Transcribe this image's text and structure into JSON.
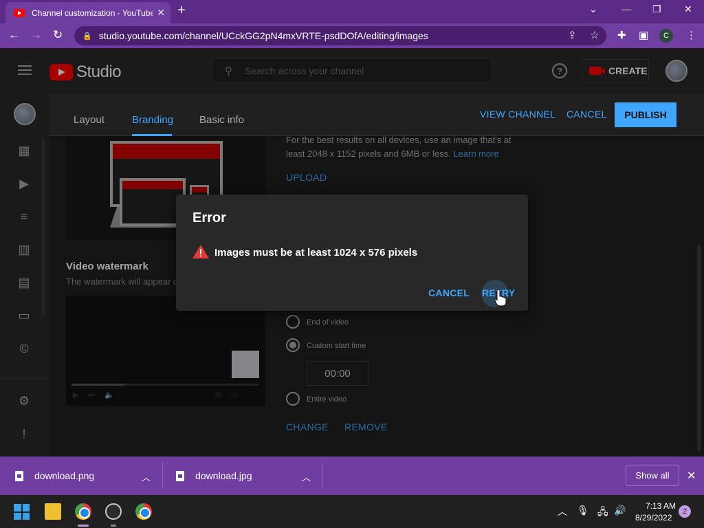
{
  "browser": {
    "tab_title": "Channel customization - YouTube",
    "url": "studio.youtube.com/channel/UCckGG2pN4mxVRTE-psdDOfA/editing/images",
    "profile_initial": "C",
    "accent_color": "#6f3ea0"
  },
  "studio": {
    "logo_text": "Studio",
    "search_placeholder": "Search across your channel",
    "create_label": "CREATE"
  },
  "tabs": [
    {
      "label": "Layout",
      "active": false
    },
    {
      "label": "Branding",
      "active": true
    },
    {
      "label": "Basic info",
      "active": false
    }
  ],
  "header_actions": {
    "view_channel": "VIEW CHANNEL",
    "cancel": "CANCEL",
    "publish": "PUBLISH"
  },
  "banner": {
    "best_text": "For the best results on all devices, use an image that's at least 2048 x 1152 pixels and 6MB or less.",
    "learn_more": "Learn more",
    "upload": "UPLOAD"
  },
  "watermark": {
    "title": "Video watermark",
    "description": "The watermark will appear o",
    "options": [
      {
        "label": "End of video",
        "checked": false
      },
      {
        "label": "Custom start time",
        "checked": true
      },
      {
        "label": "Entire video",
        "checked": false
      }
    ],
    "start_time": "00:00",
    "change": "CHANGE",
    "remove": "REMOVE"
  },
  "dialog": {
    "title": "Error",
    "message": "Images must be at least 1024 x 576 pixels",
    "cancel": "CANCEL",
    "retry": "RETRY"
  },
  "downloads": {
    "items": [
      {
        "name": "download.png"
      },
      {
        "name": "download.jpg"
      }
    ],
    "show_all": "Show all"
  },
  "taskbar": {
    "time": "7:13 AM",
    "date": "8/29/2022",
    "notification_count": "2"
  }
}
